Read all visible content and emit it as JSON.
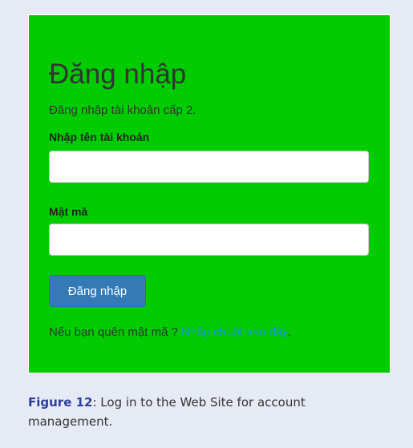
{
  "login": {
    "title": "Đăng nhập",
    "subtitle": "Đăng nhập tài khoản cấp 2.",
    "username_label": "Nhập tên tài khoản",
    "username_value": "",
    "password_label": "Mật mã",
    "password_value": "",
    "submit_label": "Đăng nhập",
    "forgot_text": "Nếu bạn quên mật mã ?",
    "forgot_link": "Nhấp chuột vào đây",
    "forgot_end": "."
  },
  "caption": {
    "label": "Figure 12",
    "text": ": Log in to the Web Site for account management."
  },
  "colors": {
    "panel": "#00cc00",
    "button": "#337ab7",
    "link": "#1a8fe0",
    "caption_label": "#2a3fa0"
  }
}
